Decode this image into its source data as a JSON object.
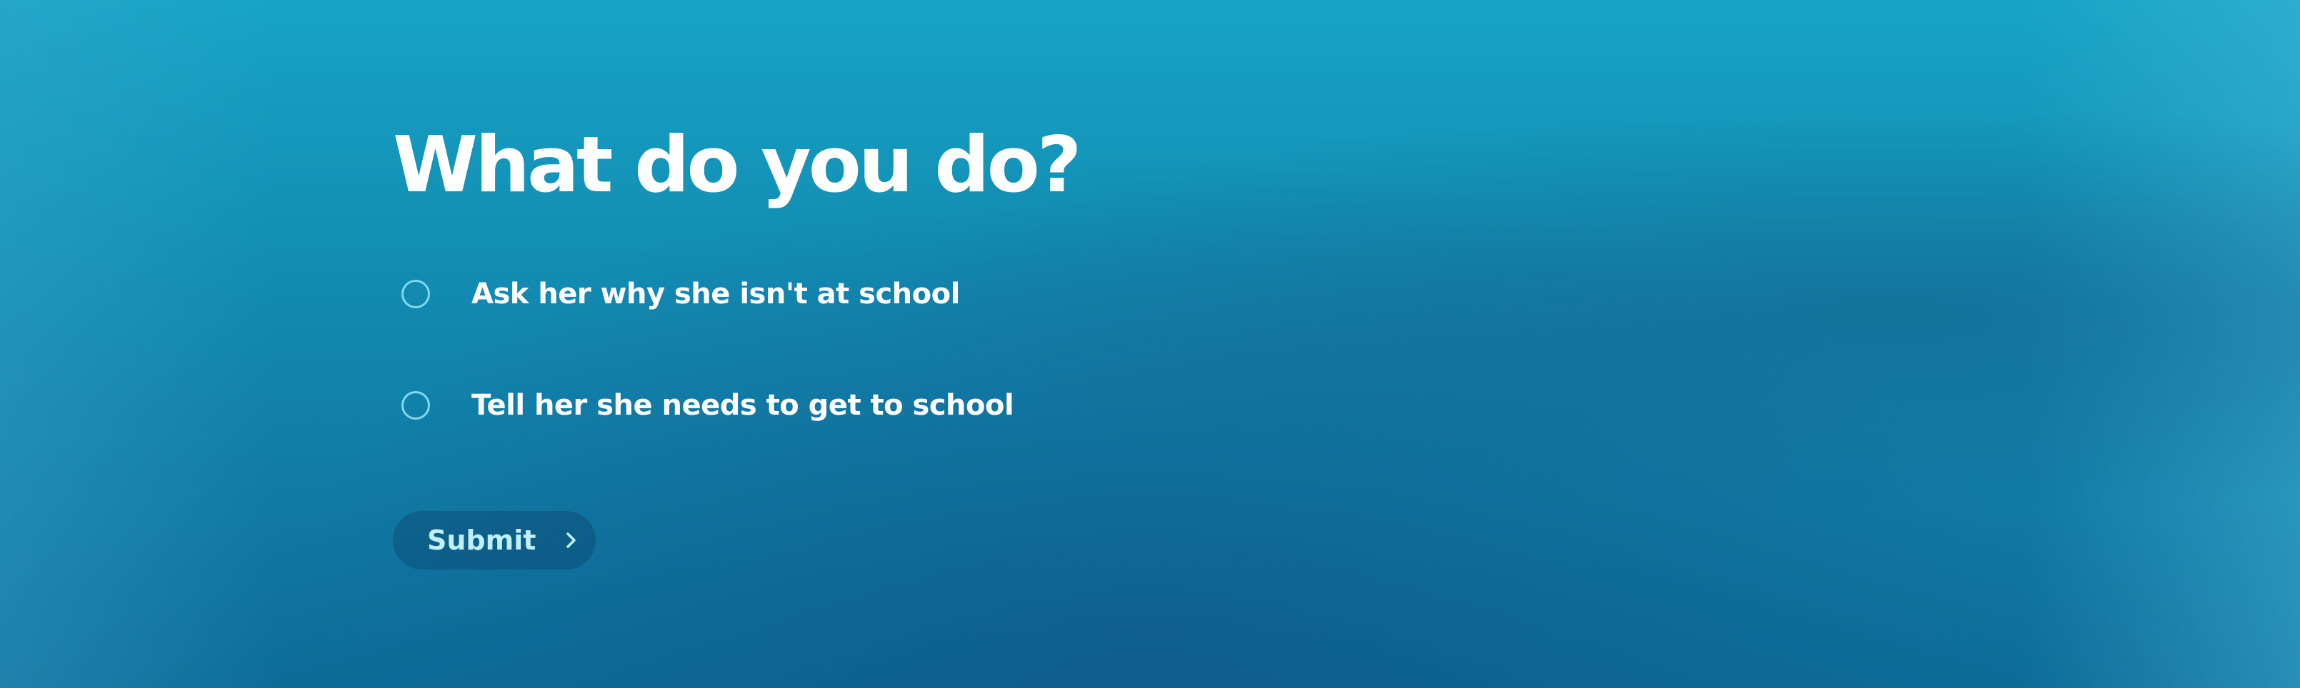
{
  "question": {
    "title": "What do you do?"
  },
  "options": [
    {
      "label": "Ask her why she isn't at school",
      "selected": false
    },
    {
      "label": "Tell her she needs to get to school",
      "selected": false
    }
  ],
  "submit": {
    "label": "Submit",
    "icon": "chevron-right-icon"
  },
  "colors": {
    "background_top": "#16a4c6",
    "background_bottom": "#0e6c99",
    "radio_border": "#7ed8ef",
    "text": "#ffffff",
    "submit_text": "#bfeffc"
  }
}
